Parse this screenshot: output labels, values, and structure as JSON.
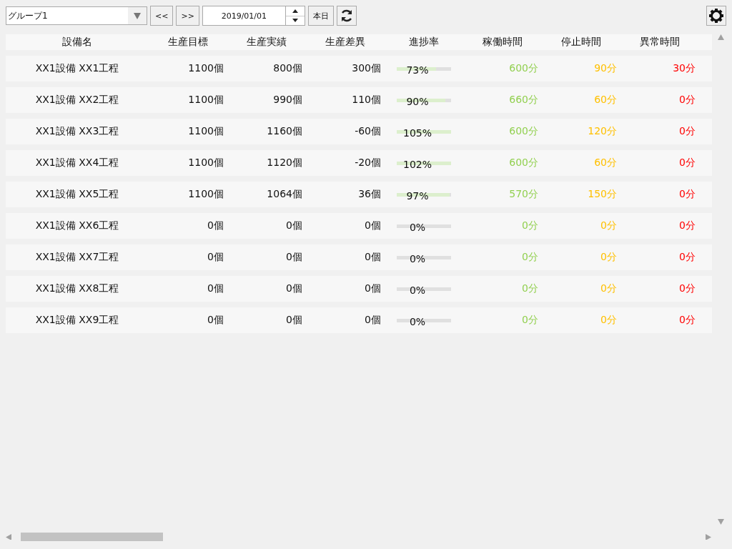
{
  "toolbar": {
    "group_select": "グループ1",
    "prev_button": "<<",
    "next_button": ">>",
    "date": "2019/01/01",
    "today_button": "本日"
  },
  "table": {
    "columns": [
      "設備名",
      "生産目標",
      "生産実績",
      "生産差異",
      "進捗率",
      "稼働時間",
      "停止時間",
      "異常時間"
    ],
    "rows": [
      {
        "name": "XX1設備 XX1工程",
        "target": "1100個",
        "actual": "800個",
        "diff": "300個",
        "progress": "73%",
        "level": 0.73,
        "operating": "600分",
        "stopped": "90分",
        "abnormal": "30分"
      },
      {
        "name": "XX1設備 XX2工程",
        "target": "1100個",
        "actual": "990個",
        "diff": "110個",
        "progress": "90%",
        "level": 0.9,
        "operating": "660分",
        "stopped": "60分",
        "abnormal": "0分"
      },
      {
        "name": "XX1設備 XX3工程",
        "target": "1100個",
        "actual": "1160個",
        "diff": "-60個",
        "progress": "105%",
        "level": 1,
        "operating": "600分",
        "stopped": "120分",
        "abnormal": "0分"
      },
      {
        "name": "XX1設備 XX4工程",
        "target": "1100個",
        "actual": "1120個",
        "diff": "-20個",
        "progress": "102%",
        "level": 1,
        "operating": "600分",
        "stopped": "60分",
        "abnormal": "0分"
      },
      {
        "name": "XX1設備 XX5工程",
        "target": "1100個",
        "actual": "1064個",
        "diff": "36個",
        "progress": "97%",
        "level": 0.97,
        "operating": "570分",
        "stopped": "150分",
        "abnormal": "0分"
      },
      {
        "name": "XX1設備 XX6工程",
        "target": "0個",
        "actual": "0個",
        "diff": "0個",
        "progress": "0%",
        "level": 0,
        "operating": "0分",
        "stopped": "0分",
        "abnormal": "0分"
      },
      {
        "name": "XX1設備 XX7工程",
        "target": "0個",
        "actual": "0個",
        "diff": "0個",
        "progress": "0%",
        "level": 0,
        "operating": "0分",
        "stopped": "0分",
        "abnormal": "0分"
      },
      {
        "name": "XX1設備 XX8工程",
        "target": "0個",
        "actual": "0個",
        "diff": "0個",
        "progress": "0%",
        "level": 0,
        "operating": "0分",
        "stopped": "0分",
        "abnormal": "0分"
      },
      {
        "name": "XX1設備 XX9工程",
        "target": "0個",
        "actual": "0個",
        "diff": "0個",
        "progress": "0%",
        "level": 0,
        "operating": "0分",
        "stopped": "0分",
        "abnormal": "0分"
      }
    ]
  }
}
